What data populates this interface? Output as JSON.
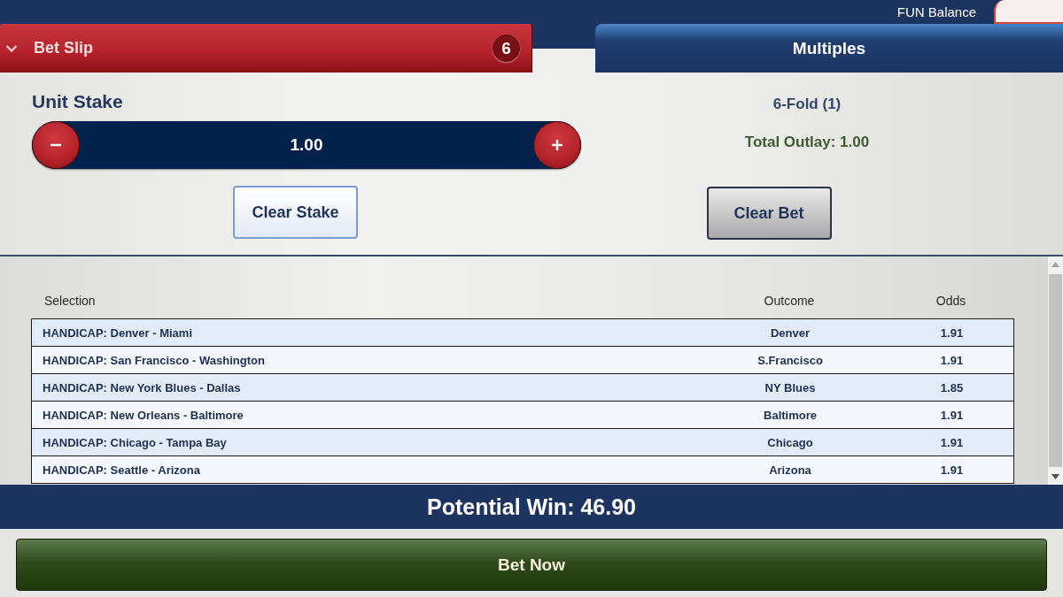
{
  "header": {
    "balance_label": "FUN Balance"
  },
  "bet_slip": {
    "title": "Bet Slip",
    "expanded": true,
    "count": "6"
  },
  "tabs": [
    {
      "label": "Multiples",
      "selected": true
    }
  ],
  "stake": {
    "label": "Unit Stake",
    "value": "1.00"
  },
  "summary": {
    "bet_type": "6-Fold (1)",
    "total_outlay": "Total Outlay: 1.00"
  },
  "actions": [
    {
      "label": "Clear Stake",
      "kind": "light"
    },
    {
      "label": "Clear Bet",
      "kind": "dark"
    }
  ],
  "table": {
    "columns": [
      "Selection",
      "Outcome",
      "Odds"
    ],
    "rows": [
      {
        "selection": "HANDICAP: Denver - Miami",
        "outcome": "Denver",
        "odds": "1.91"
      },
      {
        "selection": "HANDICAP: San Francisco - Washington",
        "outcome": "S.Francisco",
        "odds": "1.91"
      },
      {
        "selection": "HANDICAP: New York Blues - Dallas",
        "outcome": "NY Blues",
        "odds": "1.85"
      },
      {
        "selection": "HANDICAP: New Orleans - Baltimore",
        "outcome": "Baltimore",
        "odds": "1.91"
      },
      {
        "selection": "HANDICAP: Chicago - Tampa Bay",
        "outcome": "Chicago",
        "odds": "1.91"
      },
      {
        "selection": "HANDICAP: Seattle - Arizona",
        "outcome": "Arizona",
        "odds": "1.91"
      }
    ]
  },
  "potential_win": "Potential Win: 46.90",
  "place_bet": {
    "label": "Bet Now"
  }
}
